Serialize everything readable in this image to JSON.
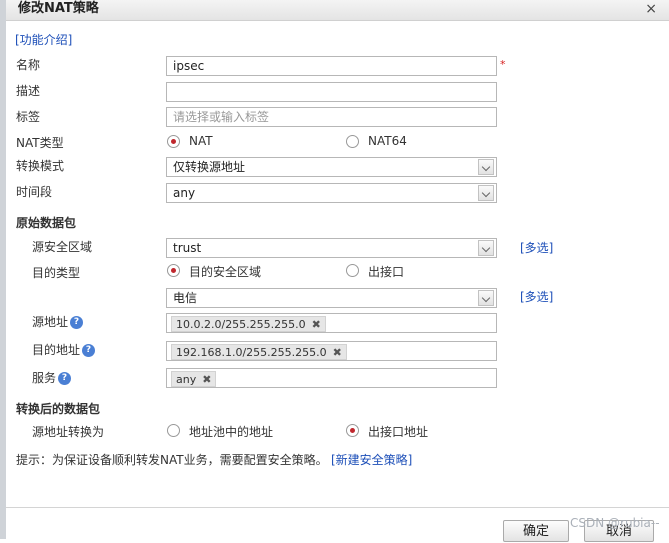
{
  "dialog": {
    "title": "修改NAT策略",
    "close": "×"
  },
  "intro_link": "[功能介绍]",
  "fields": {
    "name_label": "名称",
    "name_value": "ipsec",
    "required_mark": "*",
    "desc_label": "描述",
    "desc_value": "",
    "tag_label": "标签",
    "tag_placeholder": "请选择或输入标签",
    "nat_type_label": "NAT类型",
    "nat_type_opt1": "NAT",
    "nat_type_opt2": "NAT64",
    "mode_label": "转换模式",
    "mode_value": "仅转换源地址",
    "time_label": "时间段",
    "time_value": "any"
  },
  "original_packet": {
    "title": "原始数据包",
    "src_zone_label": "源安全区域",
    "src_zone_value": "trust",
    "multi_select": "[多选]",
    "dst_type_label": "目的类型",
    "dst_type_opt1": "目的安全区域",
    "dst_type_opt2": "出接口",
    "dst_zone_value": "电信",
    "multi_select2": "[多选]",
    "src_addr_label": "源地址",
    "src_addr_tag": "10.0.2.0/255.255.255.0",
    "dst_addr_label": "目的地址",
    "dst_addr_tag": "192.168.1.0/255.255.255.0",
    "service_label": "服务",
    "service_tag": "any",
    "help_glyph": "?",
    "remove_glyph": "✖"
  },
  "translated_packet": {
    "title": "转换后的数据包",
    "src_translate_label": "源地址转换为",
    "opt1": "地址池中的地址",
    "opt2": "出接口地址"
  },
  "hint": {
    "text": "提示：为保证设备顺利转发NAT业务，需要配置安全策略。",
    "link": "[新建安全策略]"
  },
  "buttons": {
    "ok": "确定",
    "cancel": "取消"
  },
  "watermark": "CSDN @rubia--",
  "colors": {
    "link": "#1d4fb8",
    "radio_selected": "#c0282e",
    "required": "#d62020"
  }
}
